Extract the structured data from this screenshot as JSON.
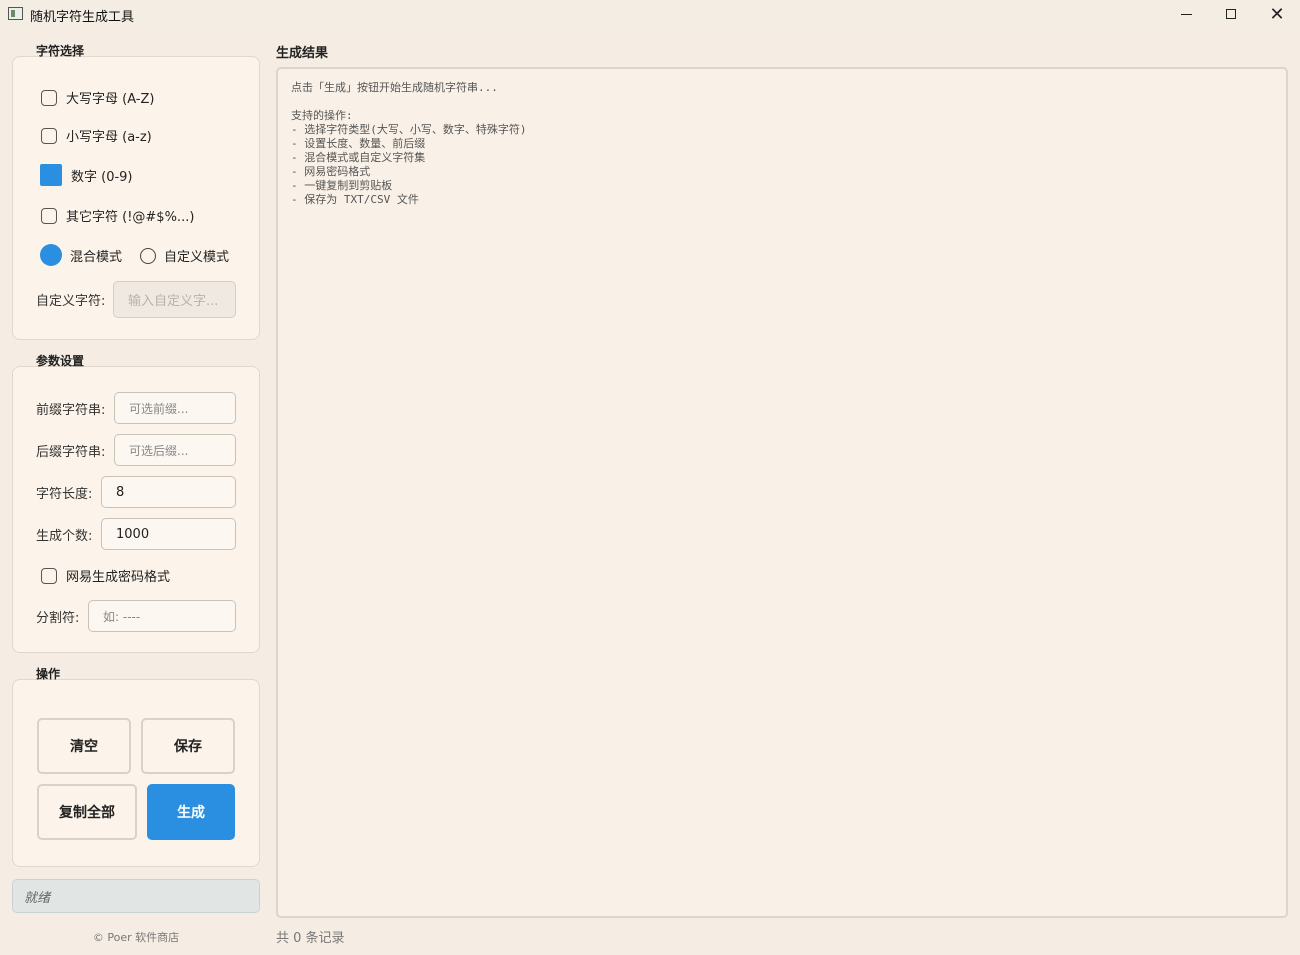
{
  "window": {
    "title": "随机字符生成工具",
    "minimize_glyph": "",
    "close_glyph": "✕"
  },
  "charset": {
    "group_title": "字符选择",
    "options": [
      {
        "label": "大写字母 (A-Z)",
        "checked": false
      },
      {
        "label": "小写字母 (a-z)",
        "checked": false
      },
      {
        "label": "数字 (0-9)",
        "checked": true
      },
      {
        "label": "其它字符 (!@#$%...)",
        "checked": false
      }
    ],
    "modes": [
      {
        "label": "混合模式",
        "selected": true
      },
      {
        "label": "自定义模式",
        "selected": false
      }
    ],
    "custom_label": "自定义字符:",
    "custom_placeholder": "输入自定义字..."
  },
  "params": {
    "group_title": "参数设置",
    "prefix_label": "前缀字符串:",
    "prefix_placeholder": "可选前缀...",
    "suffix_label": "后缀字符串:",
    "suffix_placeholder": "可选后缀...",
    "length_label": "字符长度:",
    "length_value": "8",
    "count_label": "生成个数:",
    "count_value": "1000",
    "netease_label": "网易生成密码格式",
    "netease_checked": false,
    "separator_label": "分割符:",
    "separator_placeholder": "如: ----"
  },
  "actions": {
    "group_title": "操作",
    "clear": "清空",
    "save": "保存",
    "copy_all": "复制全部",
    "generate": "生成"
  },
  "status": "就绪",
  "copyright": "© Poer 软件商店",
  "result": {
    "title": "生成结果",
    "lines": [
      "点击「生成」按钮开始生成随机字符串...",
      "",
      "支持的操作:",
      "- 选择字符类型(大写、小写、数字、特殊字符)",
      "- 设置长度、数量、前后缀",
      "- 混合模式或自定义字符集",
      "- 网易密码格式",
      "- 一键复制到剪贴板",
      "- 保存为 TXT/CSV 文件"
    ],
    "record_count": "共 0 条记录"
  },
  "colors": {
    "accent": "#2a8fe0",
    "background": "#f5ede3"
  }
}
